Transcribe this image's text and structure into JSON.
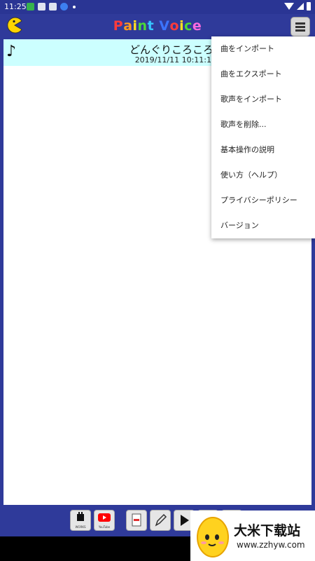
{
  "status_bar": {
    "time": "11:25"
  },
  "app": {
    "title_letters": [
      "P",
      "a",
      "i",
      "n",
      "t",
      " ",
      "V",
      "o",
      "i",
      "c",
      "e"
    ],
    "title_colors": [
      "#ff3b3b",
      "#ff9a1f",
      "#ffe01f",
      "#4cd937",
      "#36c5ff",
      "#ffffff",
      "#3b74ff",
      "#ff3b3b",
      "#ffe01f",
      "#4cd937",
      "#ff6adf"
    ]
  },
  "song": {
    "title": "どんぐりころころ",
    "date": "2019/11/11 10:11:11"
  },
  "menu": {
    "items": [
      "曲をインポート",
      "曲をエクスポート",
      "歌声をインポート",
      "歌声を削除...",
      "基本操作の説明",
      "使い方（ヘルプ）",
      "プライバシーポリシー",
      "バージョン"
    ]
  },
  "toolbar": {
    "works_label": "WORKS",
    "youtube_label": "YouTube"
  },
  "watermark": {
    "title": "大米下载站",
    "url": "www.zzhyw.com"
  }
}
